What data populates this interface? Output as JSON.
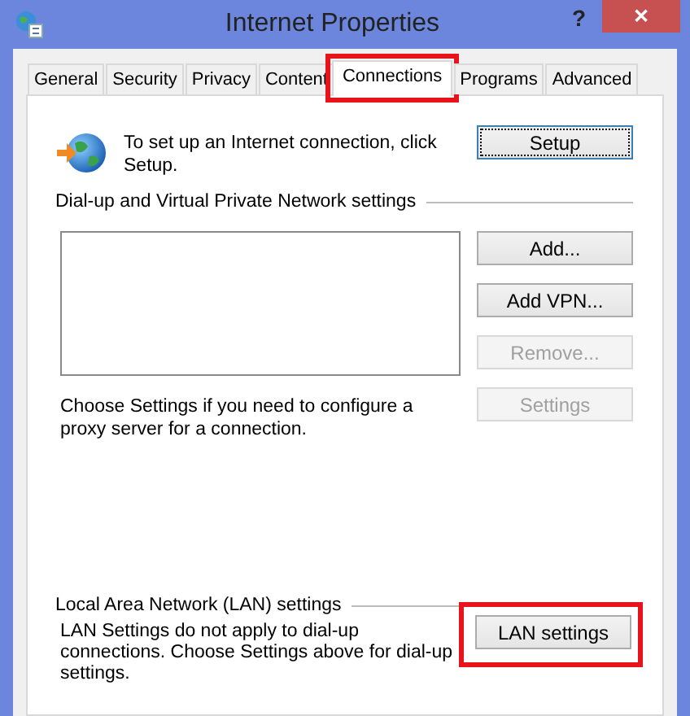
{
  "window": {
    "title": "Internet Properties",
    "help_button": "?",
    "close_button": "✕"
  },
  "tabs": [
    {
      "label": "General",
      "selected": false,
      "highlighted": false
    },
    {
      "label": "Security",
      "selected": false,
      "highlighted": false
    },
    {
      "label": "Privacy",
      "selected": false,
      "highlighted": false
    },
    {
      "label": "Content",
      "selected": false,
      "highlighted": false
    },
    {
      "label": "Connections",
      "selected": true,
      "highlighted": true
    },
    {
      "label": "Programs",
      "selected": false,
      "highlighted": false
    },
    {
      "label": "Advanced",
      "selected": false,
      "highlighted": false
    }
  ],
  "setup": {
    "text": "To set up an Internet connection, click Setup.",
    "button": {
      "label": "Setup",
      "disabled": false,
      "focused": true
    }
  },
  "dialup_group": {
    "title": "Dial-up and Virtual Private Network settings",
    "buttons": [
      {
        "label": "Add...",
        "disabled": false
      },
      {
        "label": "Add VPN...",
        "disabled": false
      },
      {
        "label": "Remove...",
        "disabled": true
      }
    ],
    "proxy_text": "Choose Settings if you need to configure a proxy server for a connection.",
    "settings_button": {
      "label": "Settings",
      "disabled": true
    }
  },
  "lan_group": {
    "title": "Local Area Network (LAN) settings",
    "text": "LAN Settings do not apply to dial-up connections. Choose Settings above for dial-up settings.",
    "button": {
      "label": "LAN settings",
      "disabled": false,
      "highlighted": true
    }
  }
}
